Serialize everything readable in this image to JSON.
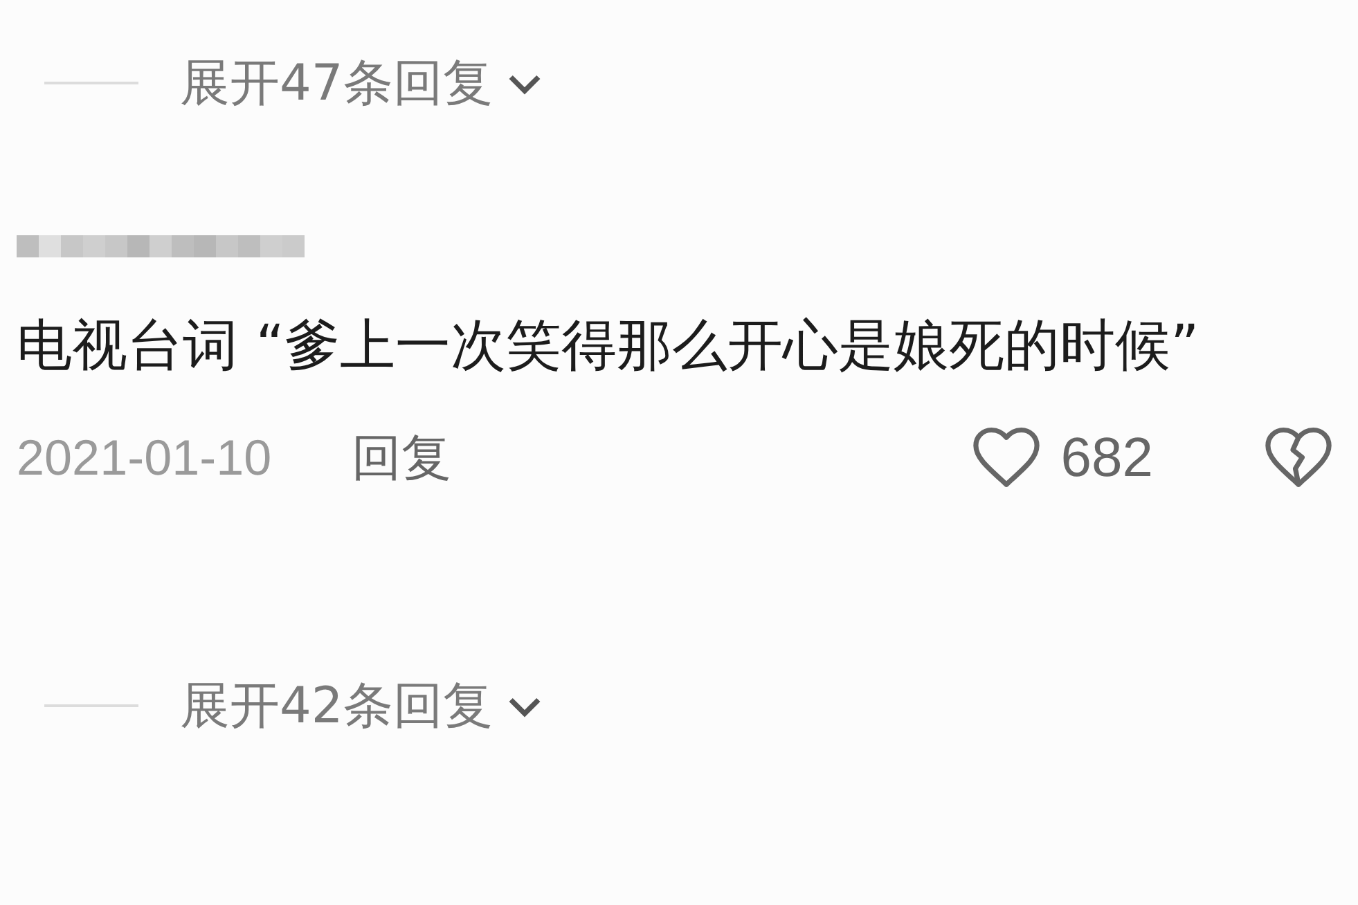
{
  "items": [
    {
      "kind": "replies_toggle",
      "label": "展开47条回复",
      "expanded": false
    },
    {
      "kind": "comment",
      "text": "电视台词 “爹上一次笑得那么开心是娘死的时候”",
      "date": "2021-01-10",
      "reply_label": "回复",
      "likes": "682",
      "liked": false,
      "disliked": false
    },
    {
      "kind": "replies_toggle",
      "label": "展开42条回复",
      "expanded": false
    }
  ]
}
